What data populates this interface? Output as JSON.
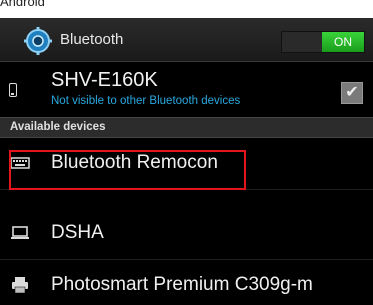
{
  "caption": "Android",
  "header": {
    "title": "Bluetooth",
    "toggle_label": "ON",
    "icon": "gear-icon"
  },
  "this_device": {
    "name": "SHV-E160K",
    "visibility": "Not visible to other Bluetooth devices",
    "icon": "phone-icon",
    "checked": true
  },
  "section": {
    "label": "Available devices"
  },
  "devices": [
    {
      "label": "Bluetooth Remocon",
      "icon": "keyboard-icon",
      "highlighted": true
    },
    {
      "label": "DSHA",
      "icon": "laptop-icon"
    },
    {
      "label": "Photosmart Premium C309g-m",
      "icon": "printer-icon"
    }
  ],
  "colors": {
    "accent_blue": "#29a9e0",
    "toggle_green": "#2bbf2d",
    "highlight_red": "#e2141c"
  }
}
